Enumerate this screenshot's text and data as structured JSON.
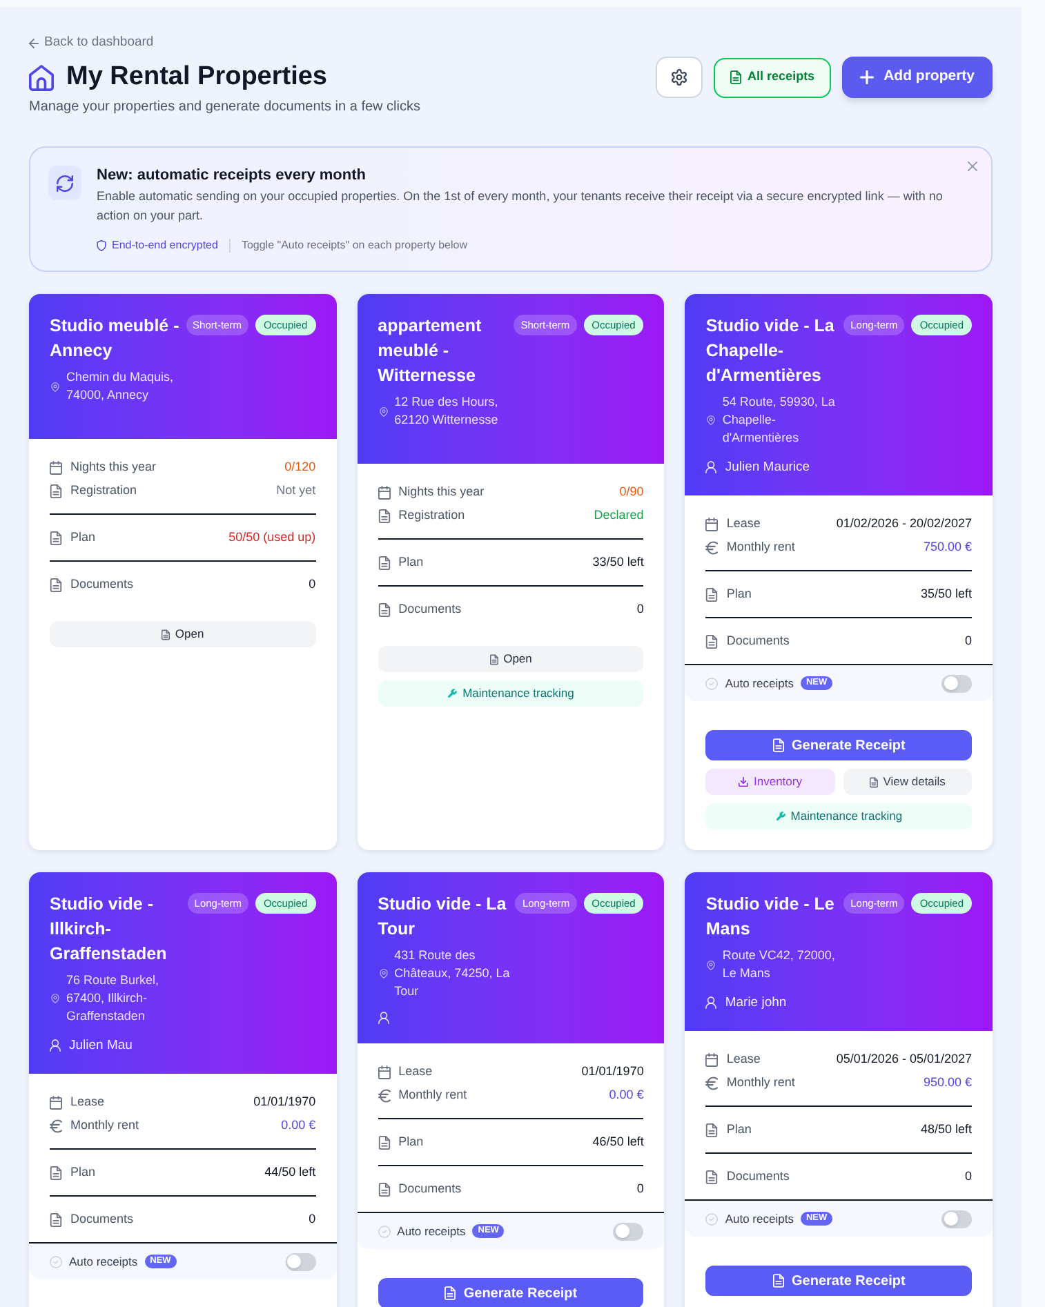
{
  "header": {
    "back_link": "Back to dashboard",
    "title": "My Rental Properties",
    "subtitle": "Manage your properties and generate documents in a few clicks",
    "buttons": [
      {
        "kind": "settings"
      },
      {
        "kind": "receipts",
        "label": "All receipts"
      },
      {
        "kind": "add",
        "label": "Add property"
      }
    ]
  },
  "banner": {
    "title": "New: automatic receipts every month",
    "text": "Enable automatic sending on your occupied properties. On the 1st of every month, your tenants receive their receipt via a secure encrypted link — with no action on your part.",
    "security_note": "End-to-end encrypted",
    "hint": "Toggle \"Auto receipts\" on each property below",
    "dismissible": true
  },
  "properties": [
    {
      "title": "Studio meublé - Annecy",
      "term": "Short-term",
      "status": "Occupied",
      "address": "Chemin du Maquis, 74000, Annecy",
      "stat_groups": [
        {
          "rows": [
            {
              "kind": "nights",
              "label": "Nights this year",
              "value": "0/120",
              "color": "#ea580c"
            },
            {
              "kind": "registration",
              "label": "Registration",
              "value": "Not yet",
              "color": "#6b7280"
            }
          ]
        },
        {
          "rows": [
            {
              "kind": "plan",
              "label": "Plan",
              "value": "50/50 (used up)",
              "color": "#dc2626"
            }
          ]
        },
        {
          "rows": [
            {
              "kind": "documents",
              "label": "Documents",
              "value": "0",
              "color": "#111827"
            }
          ]
        }
      ],
      "action_rows": [
        {
          "buttons": [
            {
              "kind": "open",
              "label": "Open"
            }
          ]
        }
      ]
    },
    {
      "title": "appartement meublé - Witternesse",
      "term": "Short-term",
      "status": "Occupied",
      "address": "12 Rue des Hours, 62120 Witternesse",
      "stat_groups": [
        {
          "rows": [
            {
              "kind": "nights",
              "label": "Nights this year",
              "value": "0/90",
              "color": "#ea580c"
            },
            {
              "kind": "registration",
              "label": "Registration",
              "value": "Declared",
              "color": "#16a34a"
            }
          ]
        },
        {
          "rows": [
            {
              "kind": "plan",
              "label": "Plan",
              "value": "33/50 left",
              "color": "#111827"
            }
          ]
        },
        {
          "rows": [
            {
              "kind": "documents",
              "label": "Documents",
              "value": "0",
              "color": "#111827"
            }
          ]
        }
      ],
      "action_rows": [
        {
          "buttons": [
            {
              "kind": "open",
              "label": "Open"
            }
          ]
        },
        {
          "buttons": [
            {
              "kind": "maintenance",
              "label": "Maintenance tracking"
            }
          ]
        }
      ]
    },
    {
      "title": "Studio vide - La Chapelle-d'Armentières",
      "term": "Long-term",
      "status": "Occupied",
      "address": "54 Route, 59930, La Chapelle-d'Armentières",
      "tenant_row": true,
      "tenant": "Julien Maurice",
      "stat_groups": [
        {
          "rows": [
            {
              "kind": "lease",
              "label": "Lease",
              "value": "01/02/2026 - 20/02/2027",
              "color": "#111827"
            },
            {
              "kind": "rent",
              "label": "Monthly rent",
              "value": "750.00 €",
              "color": "#4f46e5"
            }
          ]
        },
        {
          "rows": [
            {
              "kind": "plan",
              "label": "Plan",
              "value": "35/50 left",
              "color": "#111827"
            }
          ]
        },
        {
          "rows": [
            {
              "kind": "documents",
              "label": "Documents",
              "value": "0",
              "color": "#111827"
            }
          ]
        }
      ],
      "auto_receipts": {
        "label": "Auto receipts",
        "badge": "NEW",
        "on": false
      },
      "action_rows": [
        {
          "buttons": [
            {
              "kind": "generate",
              "label": "Generate Receipt"
            }
          ]
        },
        {
          "buttons": [
            {
              "kind": "inventory",
              "label": "Inventory"
            },
            {
              "kind": "details",
              "label": "View details"
            }
          ]
        },
        {
          "buttons": [
            {
              "kind": "maintenance",
              "label": "Maintenance tracking"
            }
          ]
        }
      ]
    },
    {
      "title": "Studio vide - Illkirch-Graffenstaden",
      "term": "Long-term",
      "status": "Occupied",
      "address": "76 Route Burkel, 67400, Illkirch-Graffenstaden",
      "tenant_row": true,
      "tenant": "Julien Mau",
      "stat_groups": [
        {
          "rows": [
            {
              "kind": "lease",
              "label": "Lease",
              "value": "01/01/1970",
              "color": "#111827"
            },
            {
              "kind": "rent",
              "label": "Monthly rent",
              "value": "0.00 €",
              "color": "#4f46e5"
            }
          ]
        },
        {
          "rows": [
            {
              "kind": "plan",
              "label": "Plan",
              "value": "44/50 left",
              "color": "#111827"
            }
          ]
        },
        {
          "rows": [
            {
              "kind": "documents",
              "label": "Documents",
              "value": "0",
              "color": "#111827"
            }
          ]
        }
      ],
      "auto_receipts": {
        "label": "Auto receipts",
        "badge": "NEW",
        "on": false
      }
    },
    {
      "title": "Studio vide - La Tour",
      "term": "Long-term",
      "status": "Occupied",
      "address": "431 Route des Châteaux, 74250, La Tour",
      "tenant_row": true,
      "stat_groups": [
        {
          "rows": [
            {
              "kind": "lease",
              "label": "Lease",
              "value": "01/01/1970",
              "color": "#111827"
            },
            {
              "kind": "rent",
              "label": "Monthly rent",
              "value": "0.00 €",
              "color": "#4f46e5"
            }
          ]
        },
        {
          "rows": [
            {
              "kind": "plan",
              "label": "Plan",
              "value": "46/50 left",
              "color": "#111827"
            }
          ]
        },
        {
          "rows": [
            {
              "kind": "documents",
              "label": "Documents",
              "value": "0",
              "color": "#111827"
            }
          ]
        }
      ],
      "auto_receipts": {
        "label": "Auto receipts",
        "badge": "NEW",
        "on": false
      },
      "action_rows": [
        {
          "buttons": [
            {
              "kind": "generate",
              "label": "Generate Receipt"
            }
          ]
        }
      ]
    },
    {
      "title": "Studio vide - Le Mans",
      "term": "Long-term",
      "status": "Occupied",
      "address": "Route VC42, 72000, Le Mans",
      "tenant_row": true,
      "tenant": "Marie john",
      "stat_groups": [
        {
          "rows": [
            {
              "kind": "lease",
              "label": "Lease",
              "value": "05/01/2026 - 05/01/2027",
              "color": "#111827"
            },
            {
              "kind": "rent",
              "label": "Monthly rent",
              "value": "950.00 €",
              "color": "#4f46e5"
            }
          ]
        },
        {
          "rows": [
            {
              "kind": "plan",
              "label": "Plan",
              "value": "48/50 left",
              "color": "#111827"
            }
          ]
        },
        {
          "rows": [
            {
              "kind": "documents",
              "label": "Documents",
              "value": "0",
              "color": "#111827"
            }
          ]
        }
      ],
      "auto_receipts": {
        "label": "Auto receipts",
        "badge": "NEW",
        "on": false
      },
      "action_rows": [
        {
          "buttons": [
            {
              "kind": "generate",
              "label": "Generate Receipt"
            }
          ]
        }
      ]
    }
  ]
}
